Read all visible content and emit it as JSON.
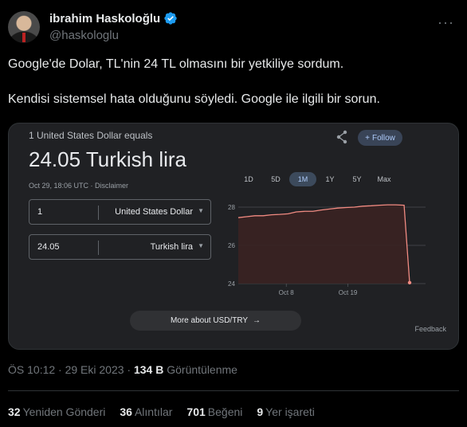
{
  "author": {
    "name": "ibrahim Haskoloğlu",
    "handle": "@haskologlu"
  },
  "tweet": {
    "line1": "Google'de Dolar, TL'nin 24 TL olmasını bir yetkiliye sordum.",
    "line2": "Kendisi sistemsel hata olduğunu söyledi. Google ile ilgili bir sorun."
  },
  "converter": {
    "equals_label": "1 United States Dollar equals",
    "result": "24.05 Turkish lira",
    "timestamp": "Oct 29, 18:06 UTC · Disclaimer",
    "follow_label": "Follow",
    "from_amount": "1",
    "from_currency": "United States Dollar",
    "to_amount": "24.05",
    "to_currency": "Turkish lira",
    "ranges": [
      "1D",
      "5D",
      "1M",
      "1Y",
      "5Y",
      "Max"
    ],
    "active_range": "1M",
    "more_about": "More about USD/TRY",
    "feedback": "Feedback"
  },
  "chart_data": {
    "type": "area",
    "y_ticks": [
      "28",
      "26",
      "24"
    ],
    "x_ticks": [
      "Oct 8",
      "Oct 19"
    ],
    "ylim": [
      24,
      28
    ],
    "x": [
      0,
      3,
      6,
      9,
      12,
      15,
      18,
      21,
      24,
      27,
      30,
      33,
      36,
      39,
      42,
      45,
      48,
      51,
      54,
      57,
      60,
      62
    ],
    "values": [
      27.45,
      27.5,
      27.55,
      27.55,
      27.6,
      27.62,
      27.65,
      27.75,
      27.78,
      27.78,
      27.85,
      27.9,
      27.95,
      27.98,
      28.0,
      28.05,
      28.07,
      28.1,
      28.12,
      28.12,
      28.1,
      24.05
    ],
    "line_color": "#f28b82",
    "fill_color": "#3a2222"
  },
  "meta": {
    "time": "ÖS 10:12 · 29 Eki 2023 · ",
    "views_count": "134 B",
    "views_label": " Görüntülenme"
  },
  "stats": {
    "retweets": "32",
    "retweets_label": "Yeniden Gönderi",
    "quotes": "36",
    "quotes_label": "Alıntılar",
    "likes": "701",
    "likes_label": "Beğeni",
    "bookmarks": "9",
    "bookmarks_label": "Yer işareti"
  }
}
